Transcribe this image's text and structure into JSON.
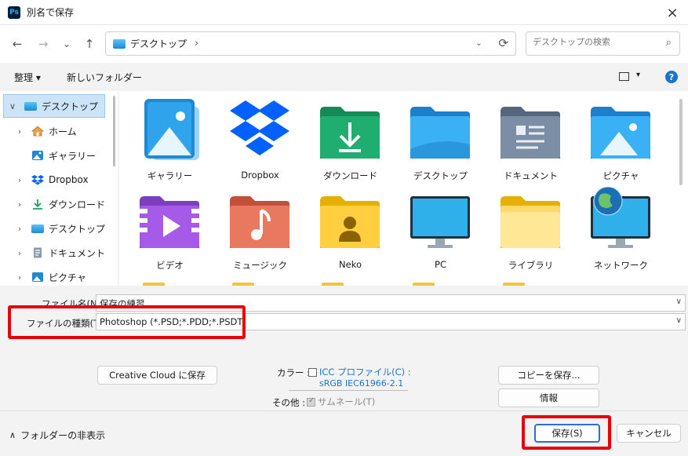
{
  "window": {
    "title": "別名で保存",
    "app_icon_text": "Ps",
    "close_icon": "×"
  },
  "nav": {
    "back_icon": "←",
    "forward_icon": "→",
    "recent_icon": "⌄",
    "up_icon": "↑",
    "breadcrumb": "デスクトップ",
    "breadcrumb_sep": "›",
    "dropdown_icon": "⌄",
    "refresh_icon": "⟳",
    "search_placeholder": "デスクトップの検索",
    "search_icon": "⌕"
  },
  "toolbar": {
    "organize": "整理 ▾",
    "new_folder": "新しいフォルダー",
    "view_drop": "▾",
    "help": "?"
  },
  "sidebar": {
    "items": [
      {
        "label": "デスクトップ",
        "chev": "∨",
        "icon": "desktop-icon"
      },
      {
        "label": "ホーム",
        "chev": "›",
        "icon": "home-icon"
      },
      {
        "label": "ギャラリー",
        "chev": "",
        "icon": "gallery-icon"
      },
      {
        "label": "Dropbox",
        "chev": "›",
        "icon": "dropbox-icon"
      },
      {
        "label": "ダウンロード",
        "chev": "›",
        "icon": "download-icon"
      },
      {
        "label": "デスクトップ",
        "chev": "›",
        "icon": "desktop-icon"
      },
      {
        "label": "ドキュメント",
        "chev": "›",
        "icon": "document-icon"
      },
      {
        "label": "ピクチャ",
        "chev": "›",
        "icon": "pictures-icon"
      }
    ]
  },
  "content": {
    "items": [
      {
        "label": "ギャラリー"
      },
      {
        "label": "Dropbox"
      },
      {
        "label": "ダウンロード"
      },
      {
        "label": "デスクトップ"
      },
      {
        "label": "ドキュメント"
      },
      {
        "label": "ピクチャ"
      },
      {
        "label": "ビデオ"
      },
      {
        "label": "ミュージック"
      },
      {
        "label": "Neko"
      },
      {
        "label": "PC"
      },
      {
        "label": "ライブラリ"
      },
      {
        "label": "ネットワーク"
      }
    ]
  },
  "form": {
    "filename_label": "ファイル名(N):",
    "filename_value": "保存の練習",
    "filetype_label": "ファイルの種類(T):",
    "filetype_value": "Photoshop (*.PSD;*.PDD;*.PSDT)",
    "cc_button": "Creative Cloud に保存",
    "color_label": "カラー :",
    "icc_link": "ICC プロファイル(C) :",
    "icc_value": "sRGB IEC61966-2.1",
    "other_label": "その他 :",
    "thumbnail_label": "サムネール(T)",
    "copy_button": "コピーを保存...",
    "info_button": "情報",
    "hide_folders": "フォルダーの非表示",
    "hide_icon": "∧",
    "save_button": "保存(S)",
    "cancel_button": "キャンセル"
  },
  "colors": {
    "highlight": "#e8000b",
    "accent": "#1874d0",
    "selected": "#cce4f7"
  }
}
